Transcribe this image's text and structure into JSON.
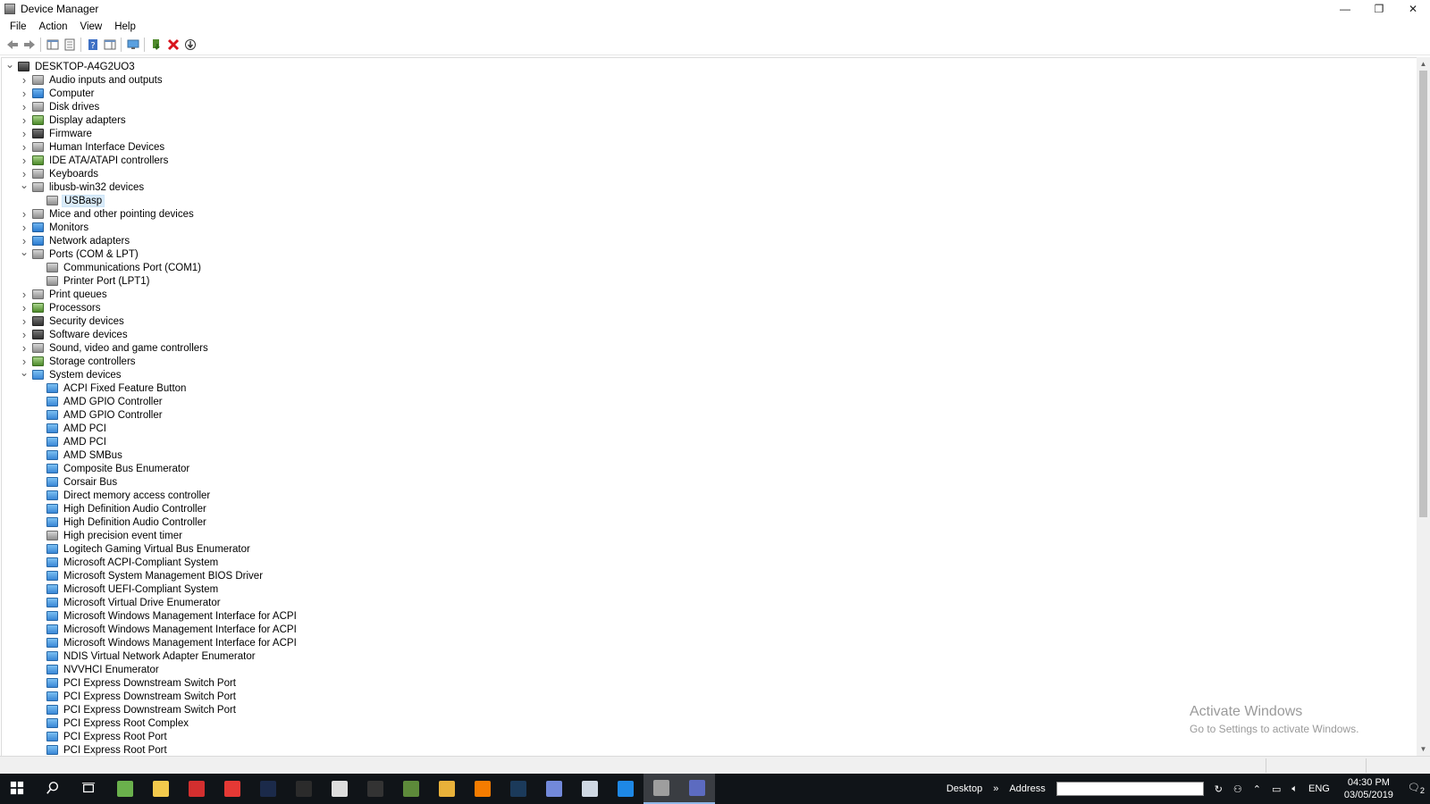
{
  "window": {
    "title": "Device Manager",
    "controls": {
      "minimize": "—",
      "maximize": "❐",
      "close": "✕"
    }
  },
  "menu": [
    "File",
    "Action",
    "View",
    "Help"
  ],
  "toolbar": [
    "back-icon",
    "forward-icon",
    "show-hide-console-tree-icon",
    "properties-icon",
    "help-icon",
    "action-pane-icon",
    "display-icon",
    "update-driver-icon",
    "uninstall-icon",
    "download-icon"
  ],
  "tree": {
    "root": "DESKTOP-A4G2UO3",
    "rows": [
      {
        "label": "DESKTOP-A4G2UO3",
        "level": 0,
        "exp": "open",
        "icon": "ic-dark"
      },
      {
        "label": "Audio inputs and outputs",
        "level": 1,
        "exp": "closed",
        "icon": "ic-grey"
      },
      {
        "label": "Computer",
        "level": 1,
        "exp": "closed",
        "icon": "ic-blue"
      },
      {
        "label": "Disk drives",
        "level": 1,
        "exp": "closed",
        "icon": "ic-grey"
      },
      {
        "label": "Display adapters",
        "level": 1,
        "exp": "closed",
        "icon": "ic-green"
      },
      {
        "label": "Firmware",
        "level": 1,
        "exp": "closed",
        "icon": "ic-dark"
      },
      {
        "label": "Human Interface Devices",
        "level": 1,
        "exp": "closed",
        "icon": "ic-grey"
      },
      {
        "label": "IDE ATA/ATAPI controllers",
        "level": 1,
        "exp": "closed",
        "icon": "ic-green"
      },
      {
        "label": "Keyboards",
        "level": 1,
        "exp": "closed",
        "icon": "ic-grey"
      },
      {
        "label": "libusb-win32 devices",
        "level": 1,
        "exp": "open",
        "icon": "ic-grey"
      },
      {
        "label": "USBasp",
        "level": 2,
        "exp": "none",
        "icon": "ic-grey",
        "selected": true
      },
      {
        "label": "Mice and other pointing devices",
        "level": 1,
        "exp": "closed",
        "icon": "ic-grey"
      },
      {
        "label": "Monitors",
        "level": 1,
        "exp": "closed",
        "icon": "ic-blue"
      },
      {
        "label": "Network adapters",
        "level": 1,
        "exp": "closed",
        "icon": "ic-blue"
      },
      {
        "label": "Ports (COM & LPT)",
        "level": 1,
        "exp": "open",
        "icon": "ic-grey"
      },
      {
        "label": "Communications Port (COM1)",
        "level": 2,
        "exp": "none",
        "icon": "ic-grey"
      },
      {
        "label": "Printer Port (LPT1)",
        "level": 2,
        "exp": "none",
        "icon": "ic-grey"
      },
      {
        "label": "Print queues",
        "level": 1,
        "exp": "closed",
        "icon": "ic-grey"
      },
      {
        "label": "Processors",
        "level": 1,
        "exp": "closed",
        "icon": "ic-green"
      },
      {
        "label": "Security devices",
        "level": 1,
        "exp": "closed",
        "icon": "ic-dark"
      },
      {
        "label": "Software devices",
        "level": 1,
        "exp": "closed",
        "icon": "ic-dark"
      },
      {
        "label": "Sound, video and game controllers",
        "level": 1,
        "exp": "closed",
        "icon": "ic-grey"
      },
      {
        "label": "Storage controllers",
        "level": 1,
        "exp": "closed",
        "icon": "ic-green"
      },
      {
        "label": "System devices",
        "level": 1,
        "exp": "open",
        "icon": "ic-sys"
      },
      {
        "label": "ACPI Fixed Feature Button",
        "level": 2,
        "exp": "none",
        "icon": "ic-sys"
      },
      {
        "label": "AMD GPIO Controller",
        "level": 2,
        "exp": "none",
        "icon": "ic-sys"
      },
      {
        "label": "AMD GPIO Controller",
        "level": 2,
        "exp": "none",
        "icon": "ic-sys"
      },
      {
        "label": "AMD PCI",
        "level": 2,
        "exp": "none",
        "icon": "ic-sys"
      },
      {
        "label": "AMD PCI",
        "level": 2,
        "exp": "none",
        "icon": "ic-sys"
      },
      {
        "label": "AMD SMBus",
        "level": 2,
        "exp": "none",
        "icon": "ic-sys"
      },
      {
        "label": "Composite Bus Enumerator",
        "level": 2,
        "exp": "none",
        "icon": "ic-sys"
      },
      {
        "label": "Corsair Bus",
        "level": 2,
        "exp": "none",
        "icon": "ic-sys"
      },
      {
        "label": "Direct memory access controller",
        "level": 2,
        "exp": "none",
        "icon": "ic-sys"
      },
      {
        "label": "High Definition Audio Controller",
        "level": 2,
        "exp": "none",
        "icon": "ic-sys"
      },
      {
        "label": "High Definition Audio Controller",
        "level": 2,
        "exp": "none",
        "icon": "ic-sys"
      },
      {
        "label": "High precision event timer",
        "level": 2,
        "exp": "none",
        "icon": "ic-grey"
      },
      {
        "label": "Logitech Gaming Virtual Bus Enumerator",
        "level": 2,
        "exp": "none",
        "icon": "ic-sys"
      },
      {
        "label": "Microsoft ACPI-Compliant System",
        "level": 2,
        "exp": "none",
        "icon": "ic-sys"
      },
      {
        "label": "Microsoft System Management BIOS Driver",
        "level": 2,
        "exp": "none",
        "icon": "ic-sys"
      },
      {
        "label": "Microsoft UEFI-Compliant System",
        "level": 2,
        "exp": "none",
        "icon": "ic-sys"
      },
      {
        "label": "Microsoft Virtual Drive Enumerator",
        "level": 2,
        "exp": "none",
        "icon": "ic-sys"
      },
      {
        "label": "Microsoft Windows Management Interface for ACPI",
        "level": 2,
        "exp": "none",
        "icon": "ic-sys"
      },
      {
        "label": "Microsoft Windows Management Interface for ACPI",
        "level": 2,
        "exp": "none",
        "icon": "ic-sys"
      },
      {
        "label": "Microsoft Windows Management Interface for ACPI",
        "level": 2,
        "exp": "none",
        "icon": "ic-sys"
      },
      {
        "label": "NDIS Virtual Network Adapter Enumerator",
        "level": 2,
        "exp": "none",
        "icon": "ic-sys"
      },
      {
        "label": "NVVHCI Enumerator",
        "level": 2,
        "exp": "none",
        "icon": "ic-sys"
      },
      {
        "label": "PCI Express Downstream Switch Port",
        "level": 2,
        "exp": "none",
        "icon": "ic-sys"
      },
      {
        "label": "PCI Express Downstream Switch Port",
        "level": 2,
        "exp": "none",
        "icon": "ic-sys"
      },
      {
        "label": "PCI Express Downstream Switch Port",
        "level": 2,
        "exp": "none",
        "icon": "ic-sys"
      },
      {
        "label": "PCI Express Root Complex",
        "level": 2,
        "exp": "none",
        "icon": "ic-sys"
      },
      {
        "label": "PCI Express Root Port",
        "level": 2,
        "exp": "none",
        "icon": "ic-sys"
      },
      {
        "label": "PCI Express Root Port",
        "level": 2,
        "exp": "none",
        "icon": "ic-sys"
      }
    ]
  },
  "watermark": {
    "line1": "Activate Windows",
    "line2": "Go to Settings to activate Windows."
  },
  "taskbar": {
    "apps": [
      {
        "name": "start-button",
        "color": "#ffffff"
      },
      {
        "name": "search-icon",
        "color": "#ffffff"
      },
      {
        "name": "task-view-icon",
        "color": "#ffffff"
      },
      {
        "name": "notepad-app-icon",
        "color": "#6ab04c"
      },
      {
        "name": "file-explorer-icon",
        "color": "#f2c94c"
      },
      {
        "name": "acrobat-app-icon",
        "color": "#d32f2f"
      },
      {
        "name": "red-app-icon",
        "color": "#e53935"
      },
      {
        "name": "photoshop-app-icon",
        "color": "#1b2a4a"
      },
      {
        "name": "dark-app-icon",
        "color": "#2b2b2b"
      },
      {
        "name": "corsair-app-icon",
        "color": "#dddddd"
      },
      {
        "name": "epic-games-icon",
        "color": "#333333"
      },
      {
        "name": "minecraft-app-icon",
        "color": "#5d8a3a"
      },
      {
        "name": "chrome-app-icon",
        "color": "#e8b13a"
      },
      {
        "name": "origin-app-icon",
        "color": "#f57c00"
      },
      {
        "name": "steam-app-icon",
        "color": "#1b3a5a"
      },
      {
        "name": "discord-app-icon",
        "color": "#7289da"
      },
      {
        "name": "window-app-icon",
        "color": "#cfd8e3"
      },
      {
        "name": "ccleaner-app-icon",
        "color": "#1e88e5"
      },
      {
        "name": "device-manager-app-icon",
        "color": "#9e9e9e",
        "active": true
      },
      {
        "name": "blue-app-icon",
        "color": "#5c6bc0",
        "active": true
      }
    ],
    "desktop_label": "Desktop",
    "address_label": "Address",
    "address_value": "",
    "lang": "ENG",
    "time": "04:30 PM",
    "date": "03/05/2019",
    "notification_count": "2"
  }
}
